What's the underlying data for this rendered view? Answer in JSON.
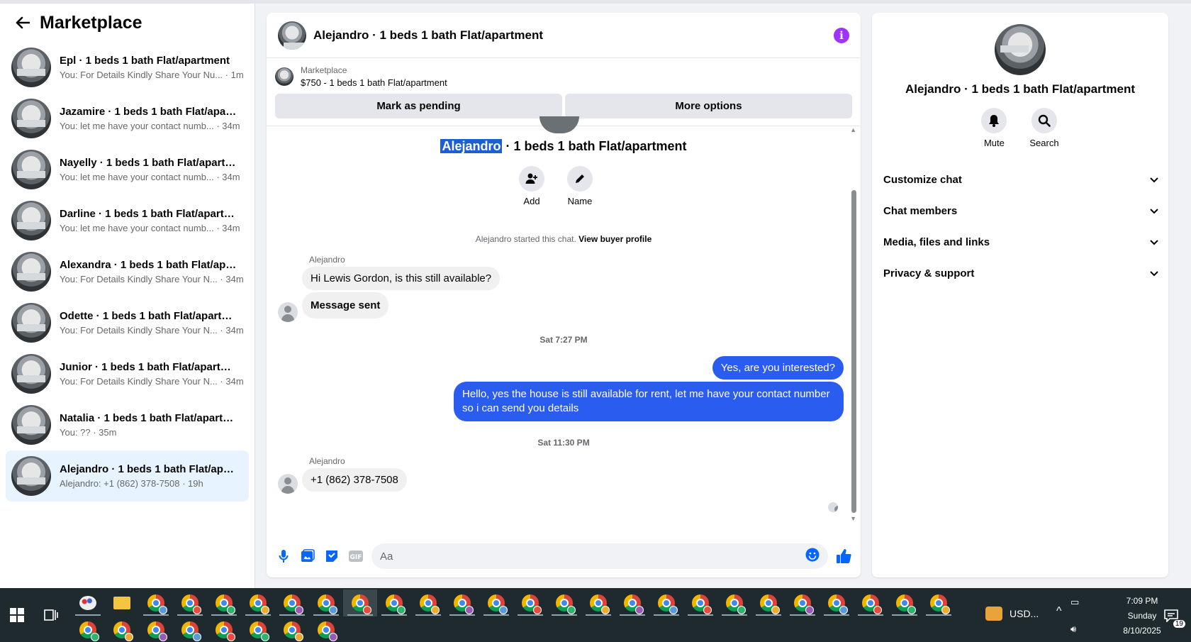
{
  "sidebar": {
    "title": "Marketplace",
    "conversations": [
      {
        "title": "Epl · 1 beds 1 bath Flat/apartment",
        "sub": "You: For Details Kindly Share Your Nu... · 1m",
        "active": false
      },
      {
        "title": "Jazamire · 1 beds 1 bath Flat/apart...",
        "sub": "You: let me have your contact numb... · 34m",
        "active": false
      },
      {
        "title": "Nayelly · 1 beds 1 bath Flat/apartm...",
        "sub": "You: let me have your contact numb... · 34m",
        "active": false
      },
      {
        "title": "Darline · 1 beds 1 bath Flat/apartm...",
        "sub": "You: let me have your contact numb... · 34m",
        "active": false
      },
      {
        "title": "Alexandra · 1 beds 1 bath Flat/apar...",
        "sub": "You: For Details Kindly Share Your N... · 34m",
        "active": false
      },
      {
        "title": "Odette · 1 beds 1 bath Flat/apartm...",
        "sub": "You: For Details Kindly Share Your N... · 34m",
        "active": false
      },
      {
        "title": "Junior · 1 beds 1 bath Flat/apartment",
        "sub": "You: For Details Kindly Share Your N... · 34m",
        "active": false
      },
      {
        "title": "Natalia · 1 beds 1 bath Flat/apartm...",
        "sub": "You: ?? · 35m",
        "active": false
      },
      {
        "title": "Alejandro · 1 beds 1 bath Flat/apar...",
        "sub": "Alejandro: +1 (862) 378-7508 · 19h",
        "active": true
      }
    ]
  },
  "chat": {
    "header_name": "Alejandro · 1 beds 1 bath Flat/apartment",
    "listing_source": "Marketplace",
    "listing_desc": "$750 - 1 beds 1 bath Flat/apartment",
    "btn_pending": "Mark as pending",
    "btn_more": "More options",
    "big_name_highlight": "Alejandro",
    "big_name_rest": " · 1 beds 1 bath Flat/apartment",
    "add_label": "Add",
    "name_label": "Name",
    "sys_text": "Alejandro started this chat.",
    "sys_link": "View buyer profile",
    "sender1": "Alejandro",
    "msg1": "Hi Lewis Gordon, is this still available?",
    "msg2": "Message sent",
    "stamp1": "Sat 7:27 PM",
    "out1": "Yes, are you interested?",
    "out2": "Hello, yes the house is still available for rent, let me have your contact number so i can send you details",
    "stamp2": "Sat 11:30 PM",
    "sender2": "Alejandro",
    "msg3": "+1 (862) 378-7508",
    "composer_placeholder": "Aa"
  },
  "right_panel": {
    "name": "Alejandro · 1 beds 1 bath Flat/apartment",
    "mute_label": "Mute",
    "search_label": "Search",
    "sections": [
      "Customize chat",
      "Chat members",
      "Media, files and links",
      "Privacy & support"
    ]
  },
  "taskbar": {
    "currency": "USD...",
    "time": "7:09 PM",
    "day": "Sunday",
    "date": "8/10/2025",
    "notif_count": "19"
  },
  "colors": {
    "accent": "#2b5cf0",
    "info": "#a033ff",
    "taskbar": "#1e2a2e"
  }
}
